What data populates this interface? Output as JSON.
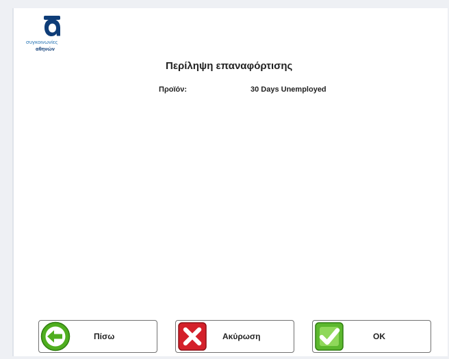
{
  "logo": {
    "line1": "συγκοινωνίες",
    "line2": "αθηνών",
    "brand_color": "#0e3d78"
  },
  "summary": {
    "title": "Περίληψη επαναφόρτισης",
    "product_label": "Προϊόν:",
    "product_value": "30 Days Unemployed"
  },
  "buttons": {
    "back_label": "Πίσω",
    "cancel_label": "Ακύρωση",
    "ok_label": "OK"
  },
  "icons": {
    "back": "arrow-left-icon",
    "cancel": "x-icon",
    "ok": "checkmark-icon"
  },
  "colors": {
    "back_icon": "#4fae1f",
    "cancel_icon": "#d4202a",
    "ok_icon": "#5cb82e"
  }
}
